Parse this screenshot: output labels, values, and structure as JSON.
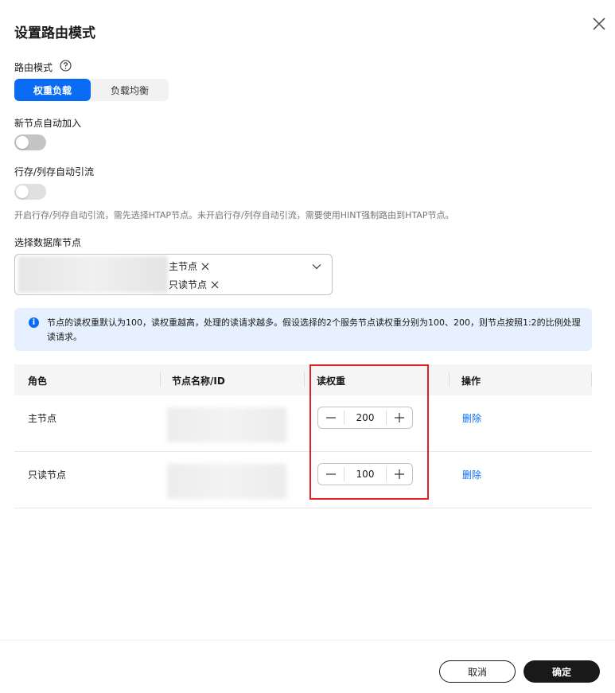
{
  "dialog": {
    "title": "设置路由模式"
  },
  "routing_mode": {
    "label": "路由模式",
    "options": [
      "权重负载",
      "负载均衡"
    ],
    "selected": "权重负载"
  },
  "auto_join": {
    "label": "新节点自动加入",
    "enabled": false
  },
  "htap_routing": {
    "label": "行存/列存自动引流",
    "enabled": false,
    "hint": "开启行存/列存自动引流，需先选择HTAP节点。未开启行存/列存自动引流，需要使用HINT强制路由到HTAP节点。"
  },
  "node_select": {
    "label": "选择数据库节点",
    "tags": [
      "主节点",
      "只读节点"
    ]
  },
  "info": {
    "text": "节点的读权重默认为100，读权重越高，处理的读请求越多。假设选择的2个服务节点读权重分别为100、200，则节点按照1:2的比例处理读请求。"
  },
  "table": {
    "headers": [
      "角色",
      "节点名称/ID",
      "读权重",
      "操作"
    ],
    "rows": [
      {
        "role": "主节点",
        "weight": "200",
        "action": "删除"
      },
      {
        "role": "只读节点",
        "weight": "100",
        "action": "删除"
      }
    ]
  },
  "footer": {
    "cancel": "取消",
    "ok": "确定"
  },
  "colors": {
    "accent": "#0a6cf5",
    "highlight_box": "#e02020",
    "primary_button": "#191919"
  }
}
